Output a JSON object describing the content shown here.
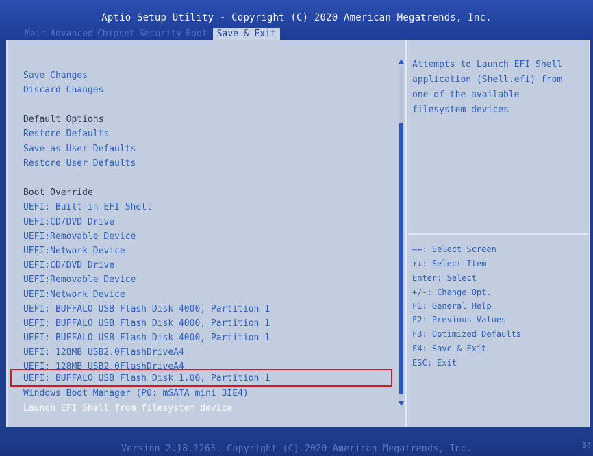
{
  "header": {
    "title": "Aptio Setup Utility - Copyright (C) 2020 American Megatrends, Inc.",
    "tabs": [
      "Main",
      "Advanced",
      "Chipset",
      "Security",
      "Boot",
      "Save & Exit"
    ],
    "active_tab": "Save & Exit"
  },
  "menu": {
    "items": [
      "Save Changes",
      "Discard Changes",
      "",
      "Default Options",
      "Restore Defaults",
      "Save as User Defaults",
      "Restore User Defaults",
      "",
      "Boot Override",
      "UEFI: Built-in EFI Shell",
      "UEFI:CD/DVD Drive",
      "UEFI:Removable Device",
      "UEFI:Network Device",
      "UEFI:CD/DVD Drive",
      "UEFI:Removable Device",
      "UEFI:Network Device",
      "UEFI: BUFFALO USB Flash Disk 4000, Partition 1",
      "UEFI: BUFFALO USB Flash Disk 4000, Partition 1",
      "UEFI: BUFFALO USB Flash Disk 4000, Partition 1",
      "UEFI: 128MB USB2.0FlashDriveA4",
      "UEFI: 128MB USB2.0FlashDriveA4",
      "UEFI: BUFFALO USB Flash Disk 1.00, Partition 1",
      "Windows Boot Manager (P0: mSATA mini 3IE4)",
      "Launch EFI Shell from filesystem device"
    ],
    "selected_item": "UEFI: BUFFALO USB Flash Disk 1.00, Partition 1",
    "highlighted_item": "Launch EFI Shell from filesystem device"
  },
  "help": {
    "lines": [
      "Attempts to Launch EFI Shell",
      "application (Shell.efi) from",
      "one of the available",
      "filesystem devices"
    ]
  },
  "keys": [
    "→←: Select Screen",
    "↑↓: Select Item",
    "Enter: Select",
    "+/-: Change Opt.",
    "F1: General Help",
    "F2: Previous Values",
    "F3: Optimized Defaults",
    "F4: Save & Exit",
    "ESC: Exit"
  ],
  "footer": {
    "version": "Version 2.18.1263. Copyright (C) 2020 American Megatrends, Inc.",
    "corner": "B4"
  },
  "colors": {
    "background": "#1f3f8e",
    "panel": "#c3cde0",
    "item_text": "#2d5fc2",
    "header_text": "#2c3a55",
    "highlight_text": "#ffffff",
    "selection_box": "#e0141c"
  }
}
